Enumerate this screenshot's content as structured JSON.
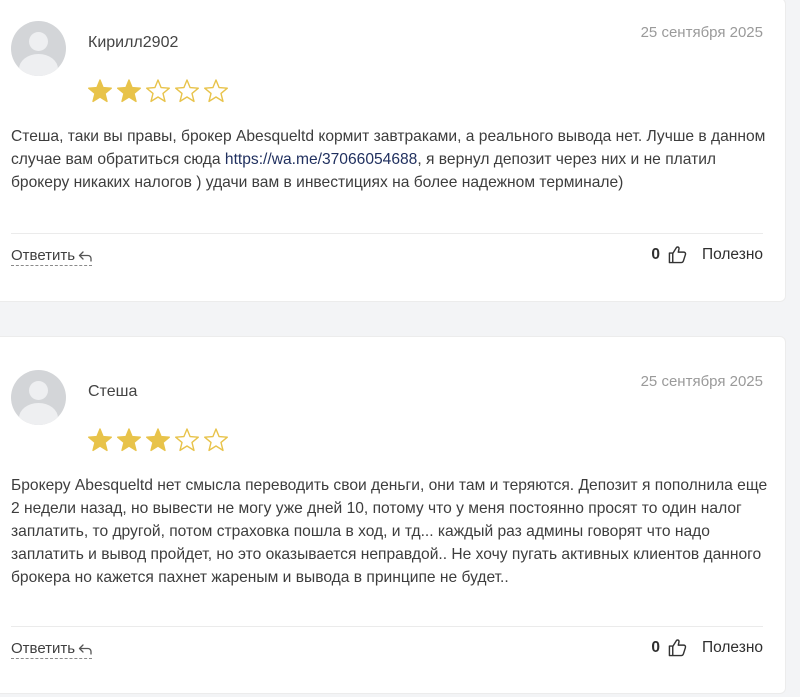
{
  "colors": {
    "star_filled": "#e8c34a",
    "star_empty": "#e8c34a",
    "link": "#1f2f5e"
  },
  "icons": {
    "reply": "reply-arrow-icon",
    "like": "thumbs-up-icon",
    "avatar": "user-placeholder-icon"
  },
  "reviews": [
    {
      "author": "Кирилл2902",
      "date": "25 сентября 2025",
      "rating": 2,
      "max_rating": 5,
      "text_before_link": "Стеша, таки вы правы, брокер Abesqueltd кормит завтраками, а реального вывода нет. Лучше в данном случае вам обратиться сюда ",
      "link": "https://wa.me/37066054688",
      "text_after_link": ", я вернул депозит через них и не платил брокеру никаких налогов ) удачи вам в инвестициях на более надежном терминале)",
      "reply_label": "Ответить",
      "useful_count": "0",
      "useful_label": "Полезно"
    },
    {
      "author": "Стеша",
      "date": "25 сентября 2025",
      "rating": 3,
      "max_rating": 5,
      "text": "Брокеру Abesqueltd нет смысла переводить свои деньги, они там и теряются. Депозит я пополнила еще 2 недели назад, но вывести не могу уже дней 10, потому что у меня постоянно просят то один налог заплатить, то другой, потом страховка пошла в ход, и тд... каждый раз админы говорят что надо заплатить и вывод пройдет, но это оказывается неправдой.. Не хочу пугать активных клиентов данного брокера но кажется пахнет жареным и вывода в принципе не будет..",
      "reply_label": "Ответить",
      "useful_count": "0",
      "useful_label": "Полезно"
    }
  ]
}
